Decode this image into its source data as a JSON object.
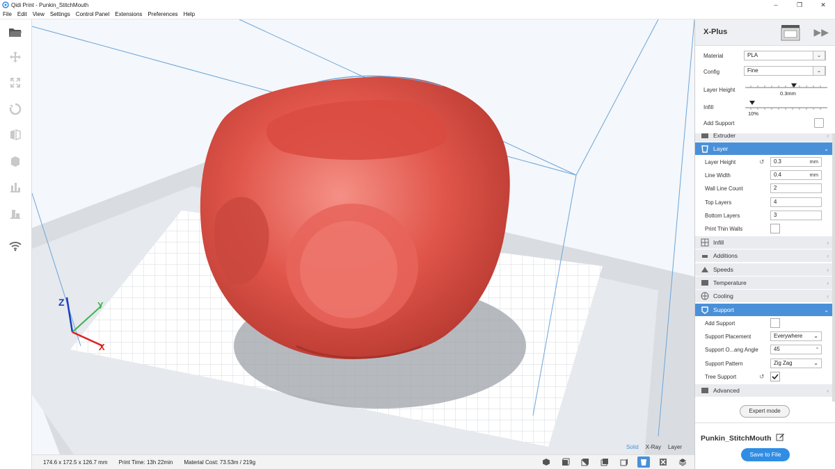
{
  "window": {
    "title": "Qidi Print - Punkin_StitchMouth",
    "controls": [
      "–",
      "❐",
      "✕"
    ]
  },
  "menu": [
    "File",
    "Edit",
    "View",
    "Settings",
    "Control Panel",
    "Extensions",
    "Preferences",
    "Help"
  ],
  "left_toolbar": [
    "folder-icon",
    "move-icon",
    "scale-icon",
    "rotate-icon",
    "mirror-icon",
    "per-model-settings-icon",
    "support-blocker-icon",
    "lay-flat-icon",
    "wifi-icon"
  ],
  "printer": {
    "name": "X-Plus",
    "material_label": "Material",
    "material_value": "PLA",
    "config_label": "Config",
    "config_value": "Fine",
    "layer_height_label": "Layer Height",
    "layer_height_value": "0.3mm",
    "infill_label": "Infill",
    "infill_value": "10%",
    "add_support_label": "Add Support"
  },
  "sections": {
    "extruder": "Extruder",
    "layer": "Layer",
    "infill": "Infill",
    "additions": "Additions",
    "speeds": "Speeds",
    "temperature": "Temperature",
    "cooling": "Cooling",
    "support": "Support",
    "advanced": "Advanced"
  },
  "layer_settings": {
    "layer_height_label": "Layer Height",
    "layer_height_value": "0.3",
    "layer_height_unit": "mm",
    "line_width_label": "Line Width",
    "line_width_value": "0.4",
    "line_width_unit": "mm",
    "wall_line_count_label": "Wall Line Count",
    "wall_line_count_value": "2",
    "top_layers_label": "Top Layers",
    "top_layers_value": "4",
    "bottom_layers_label": "Bottom Layers",
    "bottom_layers_value": "3",
    "print_thin_walls_label": "Print Thin Walls"
  },
  "support_settings": {
    "add_support_label": "Add Support",
    "placement_label": "Support Placement",
    "placement_value": "Everywhere",
    "angle_label": "Support O...ang Angle",
    "angle_value": "45",
    "angle_unit": "°",
    "pattern_label": "Support Pattern",
    "pattern_value": "Zig Zag",
    "tree_support_label": "Tree Support"
  },
  "expert_mode": "Expert mode",
  "model_name": "Punkin_StitchMouth",
  "save_button": "Save to File",
  "view_modes": {
    "solid": "Solid",
    "xray": "X-Ray",
    "layer": "Layer"
  },
  "status": {
    "dimensions": "174.6 x 172.5 x 126.7 mm",
    "print_time": "Print Time: 13h 22min",
    "material_cost": "Material Cost: 73.53m / 219g"
  },
  "axis_labels": {
    "z": "Z",
    "y": "Y",
    "x": "X"
  },
  "colors": {
    "accent": "#4a90d9",
    "model": "#e0554a",
    "save_button": "#2f8de4"
  }
}
